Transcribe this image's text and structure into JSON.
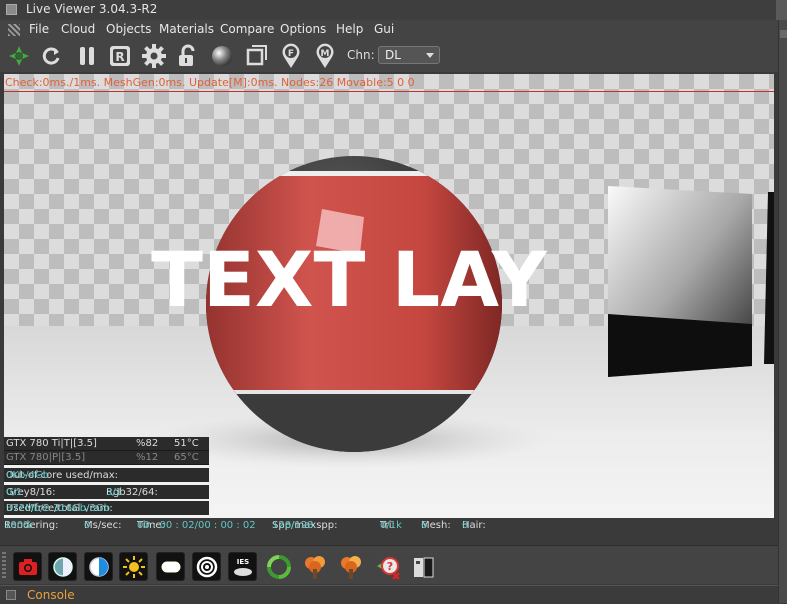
{
  "window": {
    "title": "Live Viewer 3.04.3-R2"
  },
  "menu": [
    "File",
    "Cloud",
    "Objects",
    "Materials",
    "Compare",
    "Options",
    "Help",
    "Gui"
  ],
  "toolbar": {
    "buttons": [
      "send-scene-icon",
      "restart-icon",
      "pause-icon",
      "recompile-icon",
      "settings-icon",
      "lock-icon",
      "material-ball-icon",
      "region-icon",
      "focus-picker-icon",
      "material-picker-icon"
    ],
    "channel_label": "Chn:",
    "channel_value": "DL"
  },
  "status_line": "Check:0ms./1ms. MeshGen:0ms. Update[M]:0ms. Nodes:26 Movable:5  0 0",
  "scene": {
    "sphere_text": "TEXT LAY"
  },
  "gpus": [
    {
      "name": "GTX 780 Ti|T|[3.5]",
      "load": "%82",
      "temp": "51°C"
    },
    {
      "name": "GTX 780|P|[3.5]",
      "load": "%12",
      "temp": "65°C"
    }
  ],
  "memory": {
    "out_of_core_label": "Out-of-core used/max:",
    "out_of_core_value": "0Kb/4Gb",
    "grey_label": "Grey8/16:",
    "grey_value": "0/1",
    "rgb_label": "Rgb32/64:",
    "rgb_value": "3/1",
    "vram_label": "Used/free/total vram:",
    "vram_value": "372Mb/2.316Gb/3Gb"
  },
  "render_status": {
    "rendering_label": "Rendering:",
    "rendering_value": "100%",
    "ms_label": "Ms/sec:",
    "ms_value": "0",
    "time_label": "Time:",
    "time_value": "00 : 00 : 02/00 : 00 : 02",
    "spp_label": "Spp/maxspp:",
    "spp_value": "128/128",
    "tri_label": "Tri:",
    "tri_value": "0/1k",
    "mesh_label": "Mesh:",
    "mesh_value": "6",
    "hair_label": "Hair:",
    "hair_value": "0"
  },
  "icon_bar": [
    "camera-icon",
    "contrast-icon",
    "contrast-blue-icon",
    "sun-icon",
    "area-light-icon",
    "target-light-icon",
    "ies-light-icon",
    "recycle-icon",
    "tree-icon",
    "tree-2-icon",
    "no-object-icon",
    "book-icon"
  ],
  "ies_label": "IES",
  "console": {
    "label": "Console"
  },
  "colors": {
    "accent": "#5ec8c8",
    "status": "#e0613a",
    "console": "#e8a23c"
  }
}
